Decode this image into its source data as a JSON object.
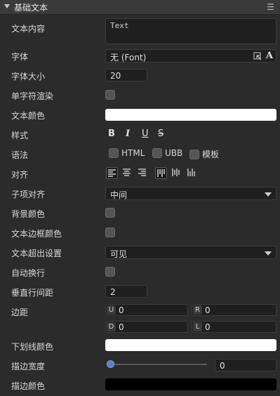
{
  "header": {
    "title": "基础文本",
    "menu_icon": "menu-icon"
  },
  "rows": {
    "content": {
      "label": "文本内容",
      "value": "Text"
    },
    "font": {
      "label": "字体",
      "value": "无 (Font)"
    },
    "font_size": {
      "label": "字体大小",
      "value": "20"
    },
    "single_char": {
      "label": "单字符渲染"
    },
    "text_color": {
      "label": "文本颜色",
      "color": "#ffffff"
    },
    "style": {
      "label": "样式",
      "bold": "B",
      "italic": "I",
      "underline": "U",
      "strike": "S"
    },
    "syntax": {
      "label": "语法",
      "html": "HTML",
      "ubb": "UBB",
      "template": "模板"
    },
    "align": {
      "label": "对齐"
    },
    "child_align": {
      "label": "子项对齐",
      "value": "中间"
    },
    "bg_color": {
      "label": "背景颜色"
    },
    "border_color": {
      "label": "文本边框颜色"
    },
    "overflow": {
      "label": "文本超出设置",
      "value": "可见"
    },
    "wrap": {
      "label": "自动换行"
    },
    "line_spacing": {
      "label": "垂直行间距",
      "value": "2"
    },
    "padding": {
      "label": "边距",
      "u_tag": "U",
      "u_value": "0",
      "r_tag": "R",
      "r_value": "0",
      "d_tag": "D",
      "d_value": "0",
      "l_tag": "L",
      "l_value": "0"
    },
    "underline_color": {
      "label": "下划线颜色",
      "color": "#ffffff"
    },
    "stroke_width": {
      "label": "描边宽度",
      "value": "0",
      "slider_fraction": 0
    },
    "stroke_color": {
      "label": "描边颜色",
      "color": "#000000"
    }
  }
}
